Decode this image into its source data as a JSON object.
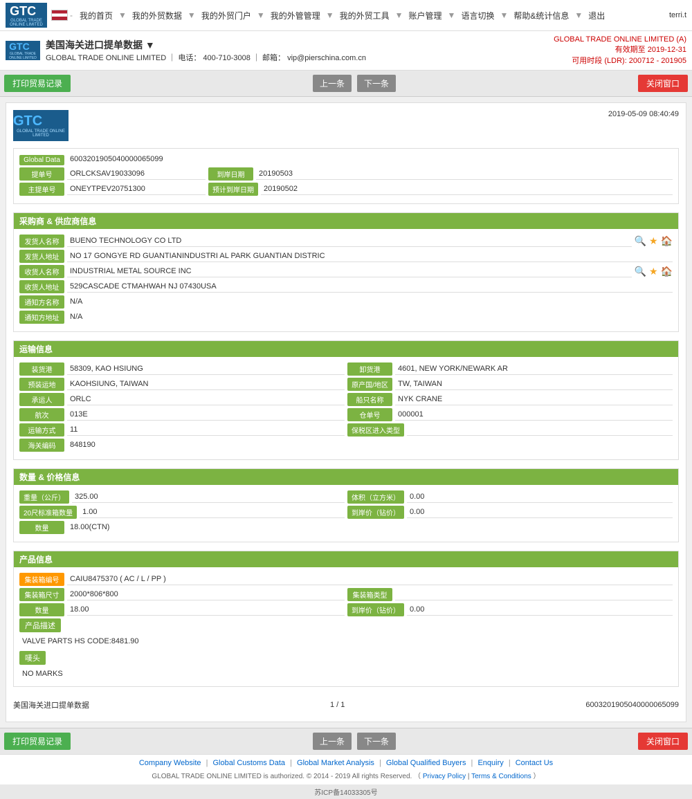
{
  "header": {
    "logo_main": "GTC",
    "logo_sub": "GLOBAL TRADE ONLINE LIMITED",
    "flag_country": "US",
    "nav_items": [
      "我的首页",
      "我的外贸数据",
      "我的外贸门户",
      "我的外管管理",
      "我的外贸工具",
      "账户管理",
      "语言切换",
      "帮助&统计信息",
      "退出"
    ],
    "top_right_company": "GLOBAL TRADE ONLINE LIMITED (A)",
    "top_right_valid": "有效期至 2019-12-31",
    "top_right_ldr": "可用时段 (LDR): 200712 - 201905",
    "company_name": "GLOBAL TRADE ONLINE LIMITED",
    "company_phone": "400-710-3008",
    "company_email": "vip@pierschina.com.cn",
    "page_title": "美国海关进口提单数据 ▼",
    "user": "terri.t"
  },
  "toolbar": {
    "print_btn": "打印贸易记录",
    "prev_btn": "上一条",
    "next_btn": "下一条",
    "close_btn": "关闭窗口"
  },
  "doc": {
    "timestamp": "2019-05-09  08:40:49",
    "global_data_label": "Global Data",
    "global_data_value": "6003201905040000065099",
    "fields": {
      "bill_no_label": "提单号",
      "bill_no_value": "ORLCKSAV19033096",
      "arrival_date_label": "到岸日期",
      "arrival_date_value": "20190503",
      "master_bill_label": "主提单号",
      "master_bill_value": "ONEYTPEV20751300",
      "est_arrival_label": "预计到岸日期",
      "est_arrival_value": "20190502"
    }
  },
  "shipper_section": {
    "title": "采购商 & 供应商信息",
    "shipper_name_label": "发货人名称",
    "shipper_name_value": "BUENO TECHNOLOGY CO LTD",
    "shipper_addr_label": "发货人地址",
    "shipper_addr_value": "NO 17 GONGYE RD GUANTIANINDUSTRI AL PARK GUANTIAN DISTRIC",
    "consignee_name_label": "收货人名称",
    "consignee_name_value": "INDUSTRIAL METAL SOURCE INC",
    "consignee_addr_label": "收货人地址",
    "consignee_addr_value": "529CASCADE CTMAHWAH NJ 07430USA",
    "notify_name_label": "通知方名称",
    "notify_name_value": "N/A",
    "notify_addr_label": "通知方地址",
    "notify_addr_value": "N/A"
  },
  "transport_section": {
    "title": "运输信息",
    "origin_port_label": "装货港",
    "origin_port_value": "58309, KAO HSIUNG",
    "dest_port_label": "卸货港",
    "dest_port_value": "4601, NEW YORK/NEWARK AR",
    "loading_place_label": "预装运地",
    "loading_place_value": "KAOHSIUNG, TAIWAN",
    "origin_country_label": "原产国/地区",
    "origin_country_value": "TW, TAIWAN",
    "carrier_label": "承运人",
    "carrier_value": "ORLC",
    "vessel_label": "船只名称",
    "vessel_value": "NYK CRANE",
    "voyage_label": "航次",
    "voyage_value": "013E",
    "container_no_label": "仓单号",
    "container_no_value": "000001",
    "transport_mode_label": "运输方式",
    "transport_mode_value": "11",
    "bonded_label": "保税区进入类型",
    "bonded_value": "",
    "customs_label": "海关编码",
    "customs_value": "848190"
  },
  "quantity_section": {
    "title": "数量 & 价格信息",
    "weight_label": "重量（公斤）",
    "weight_value": "325.00",
    "volume_label": "体积（立方米）",
    "volume_value": "0.00",
    "container20_label": "20尺标准箱数量",
    "container20_value": "1.00",
    "arrival_price_label": "到岸价（钻价）",
    "arrival_price_value": "0.00",
    "quantity_label": "数量",
    "quantity_value": "18.00(CTN)"
  },
  "product_section": {
    "title": "产品信息",
    "container_no_label": "集装箱编号",
    "container_no_value": "CAIU8475370 ( AC / L / PP )",
    "container_size_label": "集装箱尺寸",
    "container_size_value": "2000*806*800",
    "container_type_label": "集装箱类型",
    "container_type_value": "",
    "quantity_label": "数量",
    "quantity_value": "18.00",
    "arrival_price_label": "到岸价（钻价）",
    "arrival_price_value": "0.00",
    "desc_section_label": "产品描述",
    "description": "VALVE PARTS HS CODE:8481.90",
    "marks_label": "唛头",
    "marks_value": "NO MARKS"
  },
  "pagination": {
    "source_label": "美国海关进口提单数据",
    "page_info": "1 / 1",
    "record_id": "6003201905040000065099"
  },
  "footer": {
    "links": [
      "Company Website",
      "Global Customs Data",
      "Global Market Analysis",
      "Global Qualified Buyers",
      "Enquiry",
      "Contact Us"
    ],
    "copyright": "GLOBAL TRADE ONLINE LIMITED is authorized. © 2014 - 2019 All rights Reserved.",
    "privacy": "Privacy Policy",
    "terms": "Terms & Conditions",
    "icp": "苏ICP备14033305号"
  }
}
